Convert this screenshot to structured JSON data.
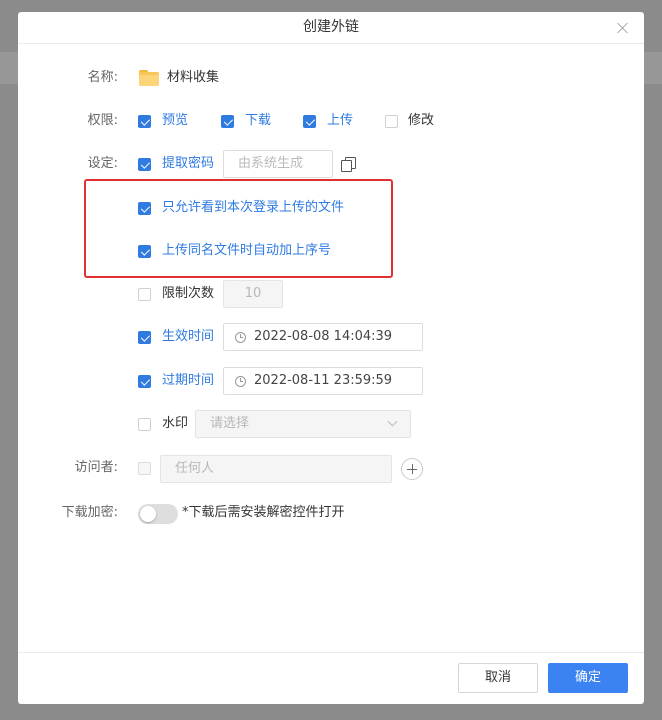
{
  "dialog": {
    "title": "创建外链"
  },
  "form": {
    "name": {
      "label": "名称:",
      "value": "材料收集",
      "icon": "folder-icon"
    },
    "permissions": {
      "label": "权限:",
      "items": [
        {
          "label": "预览",
          "checked": true
        },
        {
          "label": "下载",
          "checked": true
        },
        {
          "label": "上传",
          "checked": true
        },
        {
          "label": "修改",
          "checked": false
        }
      ]
    },
    "settings": {
      "label": "设定:",
      "extract_code": {
        "label": "提取密码",
        "checked": true,
        "placeholder": "由系统生成"
      },
      "only_own_uploads": {
        "label": "只允许看到本次登录上传的文件",
        "checked": true
      },
      "auto_sequence": {
        "label": "上传同名文件时自动加上序号",
        "checked": true
      },
      "limit_count": {
        "label": "限制次数",
        "checked": false,
        "value": "10"
      },
      "start_time": {
        "label": "生效时间",
        "checked": true,
        "value": "2022-08-08 14:04:39"
      },
      "expire_time": {
        "label": "过期时间",
        "checked": true,
        "value": "2022-08-11 23:59:59"
      },
      "watermark": {
        "label": "水印",
        "checked": false,
        "placeholder": "请选择"
      }
    },
    "visitors": {
      "label": "访问者:",
      "checked": false,
      "placeholder": "任何人"
    },
    "download_encrypt": {
      "label": "下载加密:",
      "enabled": false,
      "note": "*下载后需安装解密控件打开"
    }
  },
  "footer": {
    "cancel_label": "取消",
    "confirm_label": "确定"
  },
  "colors": {
    "accent": "#2f7be2",
    "primary_button": "#3b82f2",
    "highlight_border": "#e03030",
    "folder": "#f8c55a"
  }
}
